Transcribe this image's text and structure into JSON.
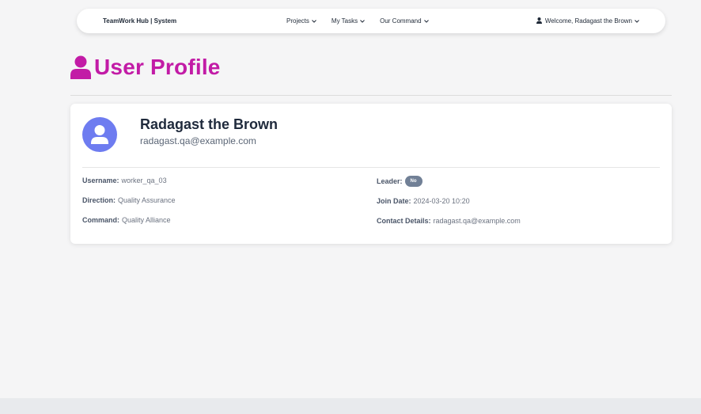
{
  "navbar": {
    "brand": "TeamWork Hub | System",
    "links": [
      {
        "label": "Projects"
      },
      {
        "label": "My Tasks"
      },
      {
        "label": "Our Command"
      }
    ],
    "user_menu_label": "Welcome, Radagast the Brown"
  },
  "page": {
    "title": "User Profile"
  },
  "profile": {
    "name": "Radagast the Brown",
    "email": "radagast.qa@example.com",
    "fields": {
      "username": {
        "label": "Username:",
        "value": "worker_qa_03"
      },
      "direction": {
        "label": "Direction:",
        "value": "Quality Assurance"
      },
      "command": {
        "label": "Command:",
        "value": "Quality Alliance"
      },
      "leader": {
        "label": "Leader:",
        "value": "No"
      },
      "join_date": {
        "label": "Join Date:",
        "value": "2024-03-20 10:20"
      },
      "contact": {
        "label": "Contact Details:",
        "value": "radagast.qa@example.com"
      }
    }
  },
  "colors": {
    "accent": "#c21ba6",
    "avatar": "#6e7cf0",
    "badge": "#718096"
  },
  "icons": {
    "heading": "user-icon",
    "avatar": "user-circle-icon",
    "user_menu": "user-icon",
    "dropdown": "chevron-down-icon"
  }
}
